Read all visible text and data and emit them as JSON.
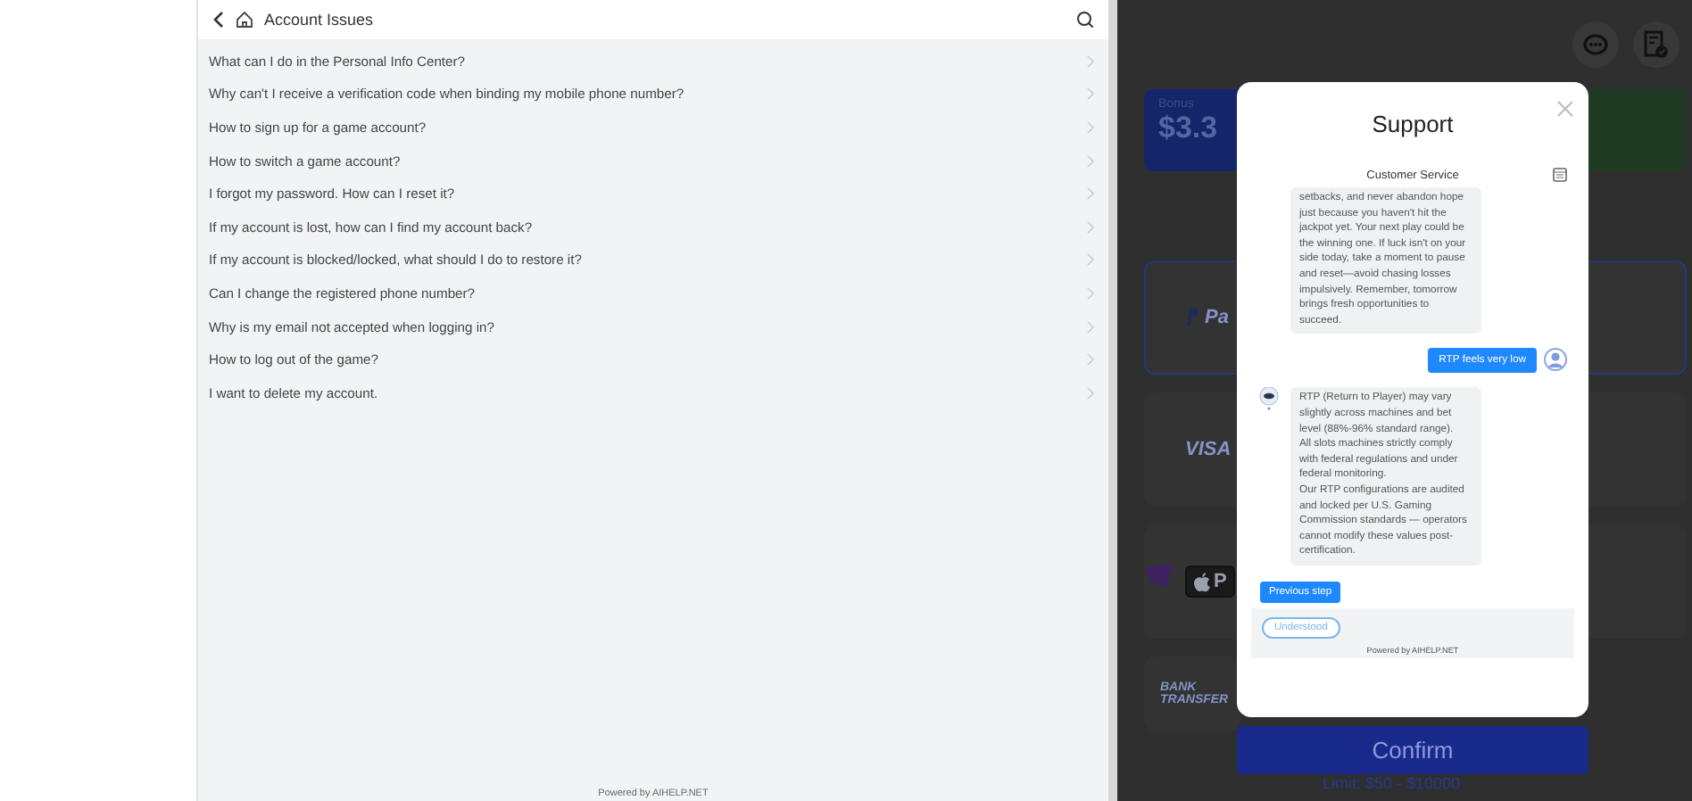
{
  "faq": {
    "title": "Account Issues",
    "questions": [
      "What can I do in the Personal Info Center?",
      "Why can't I receive a verification code when binding my mobile phone number?",
      "How to sign up for a game account?",
      "How to switch a game account?",
      "I forgot my password. How can I reset it?",
      "If my account is lost, how can I find my account back?",
      "If my account is blocked/locked, what should I do to restore it?",
      "Can I change the registered phone number?",
      "Why is my email not accepted when logging in?",
      "How to log out of the game?",
      "I want to delete my account."
    ],
    "footer": "Powered by AIHELP.NET"
  },
  "background_app": {
    "bonus_card": {
      "label": "Bonus",
      "amount": "$3.3"
    },
    "payment_methods": [
      {
        "kind": "paypal",
        "label": "Pa",
        "selected": true
      },
      {
        "kind": "visa",
        "label": "VISA",
        "selected": false
      },
      {
        "kind": "applepay",
        "label": "P",
        "selected": false
      },
      {
        "kind": "bank",
        "label": "BANK TRANSFER",
        "selected": false
      }
    ],
    "confirm_button": "Confirm",
    "limit": "Limit: $50 - $10000"
  },
  "support_modal": {
    "title": "Support",
    "chat_title": "Customer Service",
    "messages": [
      {
        "kind": "agent",
        "avatar": false,
        "text": "setbacks, and never abandon hope just because you haven't hit the jackpot yet. Your next play could be the winning one. If luck isn't on your side today, take a moment to pause and reset—avoid chasing losses impulsively. Remember, tomorrow brings fresh opportunities to succeed."
      },
      {
        "kind": "user",
        "avatar": true,
        "text": "RTP feels very low"
      },
      {
        "kind": "agent",
        "avatar": true,
        "text": "RTP (Return to Player) may vary slightly across machines and bet level (88%-96% standard range).\nAll slots machines strictly comply with federal regulations and under federal monitoring.\nOur RTP configurations are audited and locked per U.S. Gaming Commission standards — operators cannot modify these values post-certification."
      }
    ],
    "previous_button": "Previous step",
    "quick_reply": "Understood",
    "footer": "Powered by AIHELP.NET"
  }
}
